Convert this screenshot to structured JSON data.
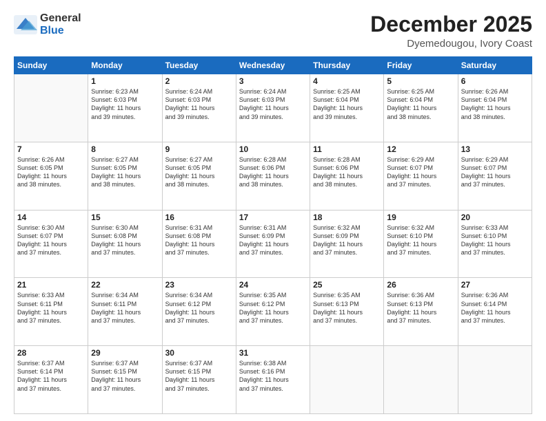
{
  "logo": {
    "general": "General",
    "blue": "Blue"
  },
  "title": {
    "month": "December 2025",
    "location": "Dyemedougou, Ivory Coast"
  },
  "weekdays": [
    "Sunday",
    "Monday",
    "Tuesday",
    "Wednesday",
    "Thursday",
    "Friday",
    "Saturday"
  ],
  "weeks": [
    [
      {
        "day": "",
        "info": ""
      },
      {
        "day": "1",
        "info": "Sunrise: 6:23 AM\nSunset: 6:03 PM\nDaylight: 11 hours\nand 39 minutes."
      },
      {
        "day": "2",
        "info": "Sunrise: 6:24 AM\nSunset: 6:03 PM\nDaylight: 11 hours\nand 39 minutes."
      },
      {
        "day": "3",
        "info": "Sunrise: 6:24 AM\nSunset: 6:03 PM\nDaylight: 11 hours\nand 39 minutes."
      },
      {
        "day": "4",
        "info": "Sunrise: 6:25 AM\nSunset: 6:04 PM\nDaylight: 11 hours\nand 39 minutes."
      },
      {
        "day": "5",
        "info": "Sunrise: 6:25 AM\nSunset: 6:04 PM\nDaylight: 11 hours\nand 38 minutes."
      },
      {
        "day": "6",
        "info": "Sunrise: 6:26 AM\nSunset: 6:04 PM\nDaylight: 11 hours\nand 38 minutes."
      }
    ],
    [
      {
        "day": "7",
        "info": "Sunrise: 6:26 AM\nSunset: 6:05 PM\nDaylight: 11 hours\nand 38 minutes."
      },
      {
        "day": "8",
        "info": "Sunrise: 6:27 AM\nSunset: 6:05 PM\nDaylight: 11 hours\nand 38 minutes."
      },
      {
        "day": "9",
        "info": "Sunrise: 6:27 AM\nSunset: 6:05 PM\nDaylight: 11 hours\nand 38 minutes."
      },
      {
        "day": "10",
        "info": "Sunrise: 6:28 AM\nSunset: 6:06 PM\nDaylight: 11 hours\nand 38 minutes."
      },
      {
        "day": "11",
        "info": "Sunrise: 6:28 AM\nSunset: 6:06 PM\nDaylight: 11 hours\nand 38 minutes."
      },
      {
        "day": "12",
        "info": "Sunrise: 6:29 AM\nSunset: 6:07 PM\nDaylight: 11 hours\nand 37 minutes."
      },
      {
        "day": "13",
        "info": "Sunrise: 6:29 AM\nSunset: 6:07 PM\nDaylight: 11 hours\nand 37 minutes."
      }
    ],
    [
      {
        "day": "14",
        "info": "Sunrise: 6:30 AM\nSunset: 6:07 PM\nDaylight: 11 hours\nand 37 minutes."
      },
      {
        "day": "15",
        "info": "Sunrise: 6:30 AM\nSunset: 6:08 PM\nDaylight: 11 hours\nand 37 minutes."
      },
      {
        "day": "16",
        "info": "Sunrise: 6:31 AM\nSunset: 6:08 PM\nDaylight: 11 hours\nand 37 minutes."
      },
      {
        "day": "17",
        "info": "Sunrise: 6:31 AM\nSunset: 6:09 PM\nDaylight: 11 hours\nand 37 minutes."
      },
      {
        "day": "18",
        "info": "Sunrise: 6:32 AM\nSunset: 6:09 PM\nDaylight: 11 hours\nand 37 minutes."
      },
      {
        "day": "19",
        "info": "Sunrise: 6:32 AM\nSunset: 6:10 PM\nDaylight: 11 hours\nand 37 minutes."
      },
      {
        "day": "20",
        "info": "Sunrise: 6:33 AM\nSunset: 6:10 PM\nDaylight: 11 hours\nand 37 minutes."
      }
    ],
    [
      {
        "day": "21",
        "info": "Sunrise: 6:33 AM\nSunset: 6:11 PM\nDaylight: 11 hours\nand 37 minutes."
      },
      {
        "day": "22",
        "info": "Sunrise: 6:34 AM\nSunset: 6:11 PM\nDaylight: 11 hours\nand 37 minutes."
      },
      {
        "day": "23",
        "info": "Sunrise: 6:34 AM\nSunset: 6:12 PM\nDaylight: 11 hours\nand 37 minutes."
      },
      {
        "day": "24",
        "info": "Sunrise: 6:35 AM\nSunset: 6:12 PM\nDaylight: 11 hours\nand 37 minutes."
      },
      {
        "day": "25",
        "info": "Sunrise: 6:35 AM\nSunset: 6:13 PM\nDaylight: 11 hours\nand 37 minutes."
      },
      {
        "day": "26",
        "info": "Sunrise: 6:36 AM\nSunset: 6:13 PM\nDaylight: 11 hours\nand 37 minutes."
      },
      {
        "day": "27",
        "info": "Sunrise: 6:36 AM\nSunset: 6:14 PM\nDaylight: 11 hours\nand 37 minutes."
      }
    ],
    [
      {
        "day": "28",
        "info": "Sunrise: 6:37 AM\nSunset: 6:14 PM\nDaylight: 11 hours\nand 37 minutes."
      },
      {
        "day": "29",
        "info": "Sunrise: 6:37 AM\nSunset: 6:15 PM\nDaylight: 11 hours\nand 37 minutes."
      },
      {
        "day": "30",
        "info": "Sunrise: 6:37 AM\nSunset: 6:15 PM\nDaylight: 11 hours\nand 37 minutes."
      },
      {
        "day": "31",
        "info": "Sunrise: 6:38 AM\nSunset: 6:16 PM\nDaylight: 11 hours\nand 37 minutes."
      },
      {
        "day": "",
        "info": ""
      },
      {
        "day": "",
        "info": ""
      },
      {
        "day": "",
        "info": ""
      }
    ]
  ]
}
